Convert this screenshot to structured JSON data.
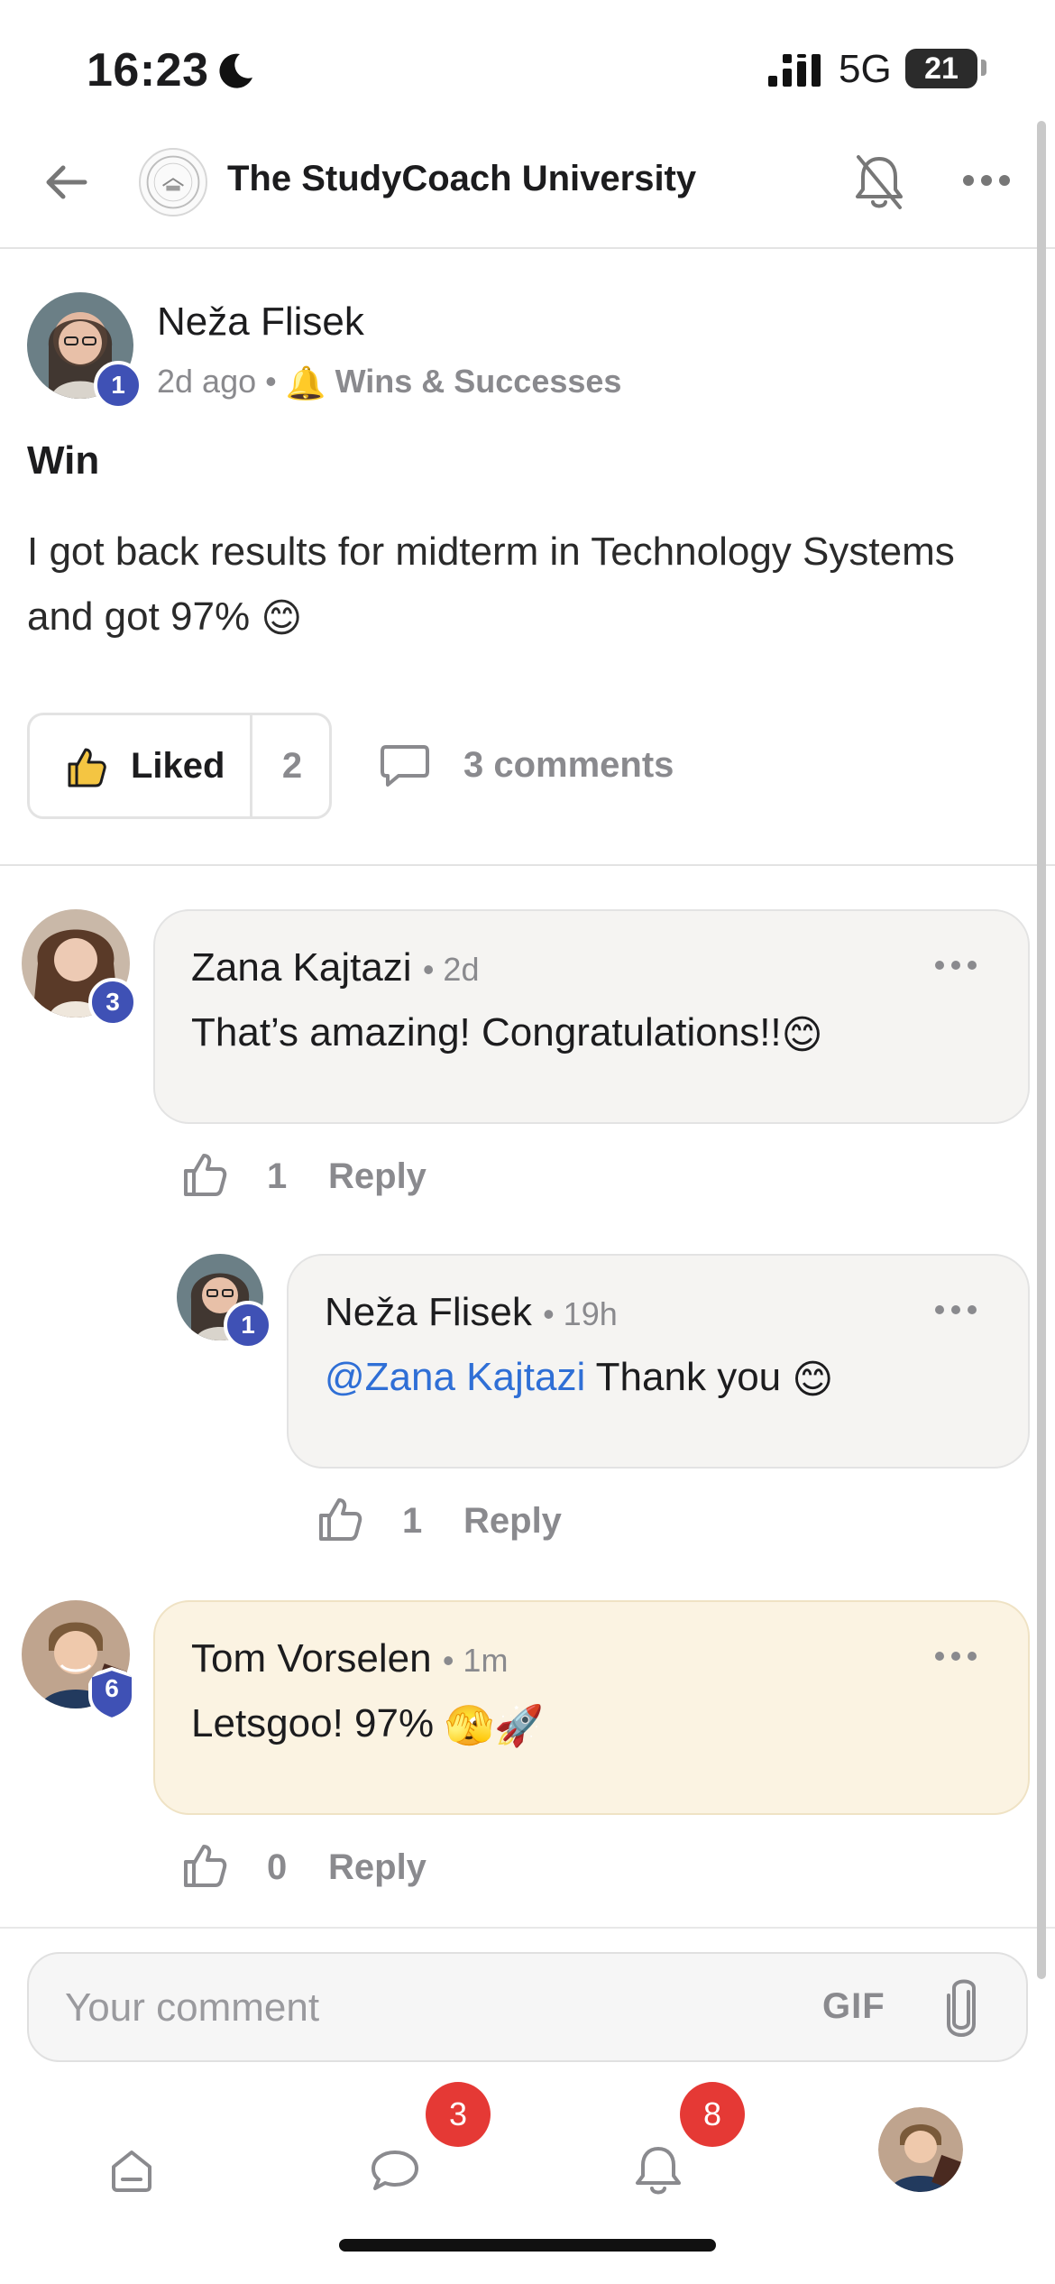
{
  "status_bar": {
    "time": "16:23",
    "network": "5G",
    "battery": "21"
  },
  "header": {
    "title": "The StudyCoach University"
  },
  "post": {
    "author": "Neža Flisek",
    "level": "1",
    "time": "2d ago",
    "separator": "•",
    "category_emoji": "🔔",
    "category": "Wins & Successes",
    "title": "Win",
    "body": "I got back results for midterm in Technology Systems and got 97%",
    "body_emoji": "😊",
    "like_label": "Liked",
    "like_count": "2",
    "comments_label": "3 comments"
  },
  "comments": [
    {
      "author": "Zana Kajtazi",
      "level": "3",
      "time": "• 2d",
      "body": "That’s amazing! Congratulations!!",
      "body_emoji": "😊",
      "like_count": "1",
      "reply_label": "Reply"
    },
    {
      "author": "Neža Flisek",
      "level": "1",
      "time": "• 19h",
      "mention": "@Zana Kajtazi",
      "body": " Thank you ",
      "body_emoji": "😊",
      "like_count": "1",
      "reply_label": "Reply"
    },
    {
      "author": "Tom Vorselen",
      "level": "6",
      "time": "• 1m",
      "body": "Letsgoo! 97% ",
      "body_emoji": "🫣🚀",
      "like_count": "0",
      "reply_label": "Reply"
    }
  ],
  "composer": {
    "placeholder": "Your comment",
    "gif_label": "GIF"
  },
  "nav": {
    "chat_badge": "3",
    "notifications_badge": "8"
  },
  "colors": {
    "accent_badge": "#3f51b5",
    "notification_red": "#e53935",
    "mention_blue": "#2f6fd6",
    "highlight_bubble": "#fbf3e2"
  }
}
